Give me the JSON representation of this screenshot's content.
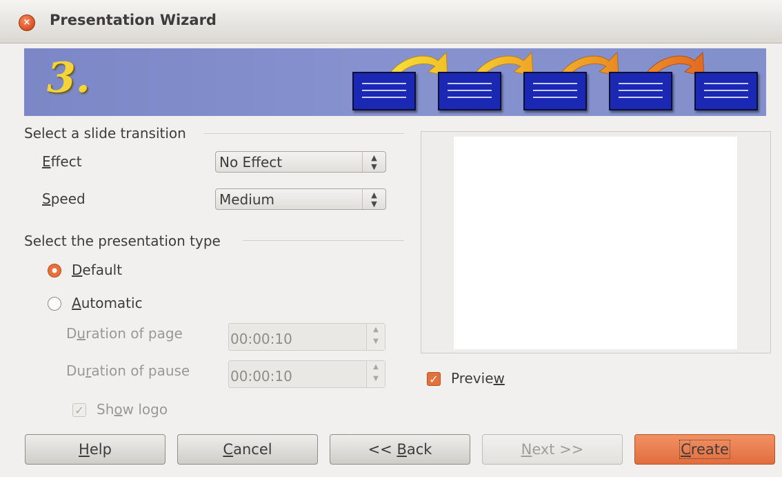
{
  "window": {
    "title": "Presentation Wizard"
  },
  "banner": {
    "step": "3."
  },
  "transition": {
    "heading": "Select a slide transition",
    "effect_label_mn": "E",
    "effect_label_rest": "ffect",
    "effect_value": "No Effect",
    "speed_label_mn": "S",
    "speed_label_rest": "peed",
    "speed_value": "Medium"
  },
  "type": {
    "heading": "Select the presentation type",
    "default_mn": "D",
    "default_rest": "efault",
    "automatic_mn": "A",
    "automatic_rest": "utomatic",
    "duration_page_pre": "D",
    "duration_page_mn": "u",
    "duration_page_post": "ration of page",
    "duration_page_value": "00:00:10",
    "duration_pause_pre": "Du",
    "duration_pause_mn": "r",
    "duration_pause_post": "ation of pause",
    "duration_pause_value": "00:00:10",
    "show_logo_pre": "Sh",
    "show_logo_mn": "o",
    "show_logo_post": "w logo",
    "selected": "Default"
  },
  "preview": {
    "label_pre": "Previe",
    "label_mn": "w",
    "checked": true
  },
  "buttons": {
    "help_mn": "H",
    "help_rest": "elp",
    "cancel_mn": "C",
    "cancel_rest": "ancel",
    "back_pre": "<< ",
    "back_mn": "B",
    "back_rest": "ack",
    "next_mn": "N",
    "next_rest": "ext >>",
    "create_mn": "C",
    "create_rest": "reate"
  },
  "colors": {
    "accent": "#e4703d",
    "banner": "#8490cd",
    "slide_icon": "#1b28b4"
  }
}
